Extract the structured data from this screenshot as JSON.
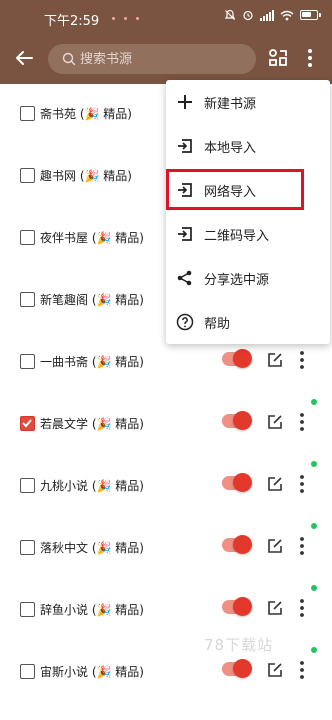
{
  "status_bar": {
    "time": "下午2:59"
  },
  "toolbar": {
    "search_placeholder": "搜索书源"
  },
  "sources": [
    {
      "name": "斋书苑 (🎉 精品)",
      "checked": false,
      "enabled": true,
      "online": false
    },
    {
      "name": "趣书网 (🎉 精品)",
      "checked": false,
      "enabled": true,
      "online": false
    },
    {
      "name": "夜伴书屋 (🎉 精品)",
      "checked": false,
      "enabled": true,
      "online": false
    },
    {
      "name": "新笔趣阁 (🎉 精品)",
      "checked": false,
      "enabled": true,
      "online": false
    },
    {
      "name": "一曲书斋 (🎉 精品)",
      "checked": false,
      "enabled": true,
      "online": true
    },
    {
      "name": "若晨文学 (🎉 精品)",
      "checked": true,
      "enabled": true,
      "online": true
    },
    {
      "name": "九桃小说 (🎉 精品)",
      "checked": false,
      "enabled": true,
      "online": true
    },
    {
      "name": "落秋中文 (🎉 精品)",
      "checked": false,
      "enabled": true,
      "online": true
    },
    {
      "name": "辞鱼小说 (🎉 精品)",
      "checked": false,
      "enabled": true,
      "online": true
    },
    {
      "name": "宙斯小说 (🎉 精品)",
      "checked": false,
      "enabled": true,
      "online": true
    }
  ],
  "menu": {
    "items": [
      {
        "label": "新建书源",
        "icon": "plus-icon"
      },
      {
        "label": "本地导入",
        "icon": "import-icon"
      },
      {
        "label": "网络导入",
        "icon": "import-icon",
        "highlighted": true
      },
      {
        "label": "二维码导入",
        "icon": "import-icon"
      },
      {
        "label": "分享选中源",
        "icon": "share-icon"
      },
      {
        "label": "帮助",
        "icon": "help-icon"
      }
    ]
  },
  "watermark": "78下载站",
  "colors": {
    "toolbar": "#7a5440",
    "accent": "#e3382c",
    "online_dot": "#22c55e",
    "highlight": "#e0122b"
  }
}
